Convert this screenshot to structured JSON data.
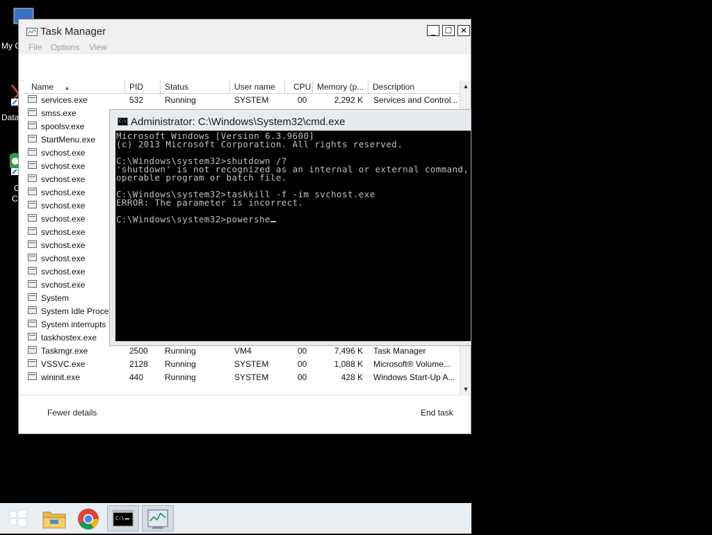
{
  "desktop": {
    "icons": [
      {
        "label": "My C",
        "icon": "computer-icon"
      },
      {
        "label": "Data",
        "icon": "database-shortcut-icon"
      },
      {
        "label": "G",
        "icon": "chrome-shortcut-icon"
      },
      {
        "label": "C",
        "icon": "chrome-shortcut-icon"
      }
    ]
  },
  "task_manager": {
    "title": "Task Manager",
    "menu": [
      "File",
      "Options",
      "View"
    ],
    "buttons": {
      "minimize": "_",
      "maximize": "☐",
      "close": "✕"
    },
    "columns": [
      "Name",
      "PID",
      "Status",
      "User name",
      "CPU",
      "Memory (p...",
      "Description"
    ],
    "sort_indicator": "▲",
    "rows": [
      {
        "name": "services.exe",
        "pid": "532",
        "status": "Running",
        "user": "SYSTEM",
        "cpu": "00",
        "memory": "2,292 K",
        "description": "Services and Control..."
      },
      {
        "name": "smss.exe"
      },
      {
        "name": "spoolsv.exe"
      },
      {
        "name": "StartMenu.exe"
      },
      {
        "name": "svchost.exe"
      },
      {
        "name": "svchost.exe"
      },
      {
        "name": "svchost.exe"
      },
      {
        "name": "svchost.exe"
      },
      {
        "name": "svchost.exe"
      },
      {
        "name": "svchost.exe"
      },
      {
        "name": "svchost.exe"
      },
      {
        "name": "svchost.exe"
      },
      {
        "name": "svchost.exe"
      },
      {
        "name": "svchost.exe"
      },
      {
        "name": "svchost.exe"
      },
      {
        "name": "System"
      },
      {
        "name": "System Idle Proces"
      },
      {
        "name": "System interrupts"
      },
      {
        "name": "taskhostex.exe"
      },
      {
        "name": "Taskmgr.exe",
        "pid": "2500",
        "status": "Running",
        "user": "VM4",
        "cpu": "00",
        "memory": "7,496 K",
        "description": "Task Manager"
      },
      {
        "name": "VSSVC.exe",
        "pid": "2128",
        "status": "Running",
        "user": "SYSTEM",
        "cpu": "00",
        "memory": "1,088 K",
        "description": "Microsoft® Volume..."
      },
      {
        "name": "wininit.exe",
        "pid": "440",
        "status": "Running",
        "user": "SYSTEM",
        "cpu": "00",
        "memory": "428 K",
        "description": "Windows Start-Up A..."
      }
    ],
    "footer": {
      "fewer_details": "Fewer details",
      "end_task": "End task"
    }
  },
  "cmd": {
    "title": "Administrator: C:\\Windows\\System32\\cmd.exe",
    "icon_text": "C:\\",
    "lines": [
      "Microsoft Windows [Version 6.3.9600]",
      "(c) 2013 Microsoft Corporation. All rights reserved.",
      "",
      "C:\\Windows\\system32>shutdown /?",
      "'shutdown' is not recognized as an internal or external command,",
      "operable program or batch file.",
      "",
      "C:\\Windows\\system32>taskkill -f -im svchost.exe",
      "ERROR: The parameter is incorrect.",
      "",
      "C:\\Windows\\system32>powershe"
    ]
  },
  "taskbar": {
    "items": [
      {
        "icon": "windows-start-icon",
        "active": false
      },
      {
        "icon": "file-explorer-icon",
        "active": false
      },
      {
        "icon": "chrome-icon",
        "active": false
      },
      {
        "icon": "command-prompt-icon",
        "active": true
      },
      {
        "icon": "task-manager-icon",
        "active": true
      }
    ]
  }
}
